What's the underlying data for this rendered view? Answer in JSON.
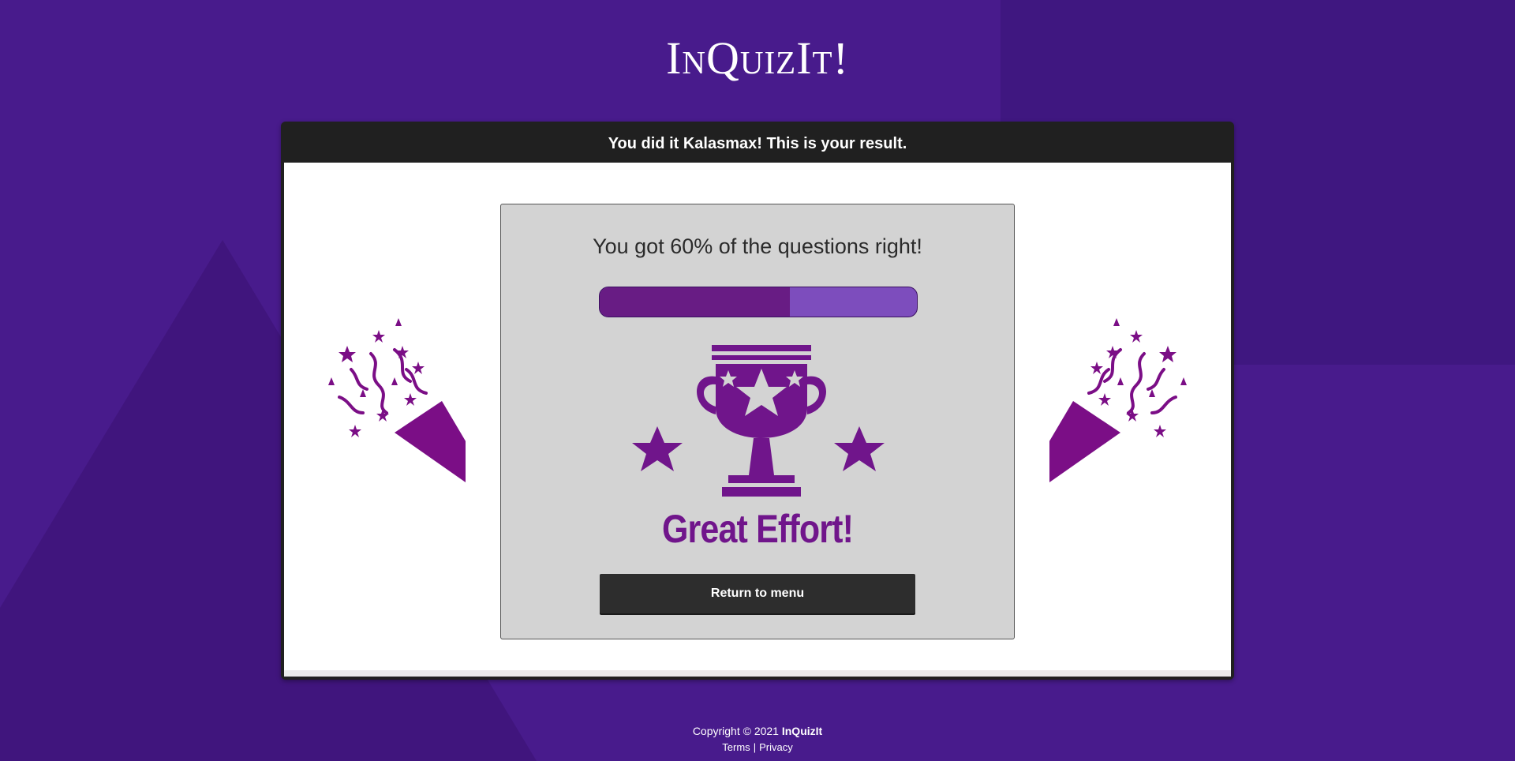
{
  "app": {
    "logo": "InQuizIt!"
  },
  "card": {
    "header": "You did it Kalasmax! This is your result."
  },
  "result": {
    "message": "You got 60% of the questions right!",
    "score_fraction": 0.6,
    "badge_text": "Great Effort!",
    "return_button": "Return to menu"
  },
  "footer": {
    "copyright": "Copyright © 2021",
    "brand": "InQuizIt",
    "terms": "Terms",
    "separator": "|",
    "privacy": "Privacy"
  },
  "colors": {
    "background": "#481b8c",
    "accent_purple": "#70158b",
    "progress_fill": "#681c84",
    "progress_track": "#7d4dbd",
    "header_dark": "#202020"
  },
  "icons": {
    "confetti": "party-popper-icon",
    "trophy": "trophy-icon"
  }
}
